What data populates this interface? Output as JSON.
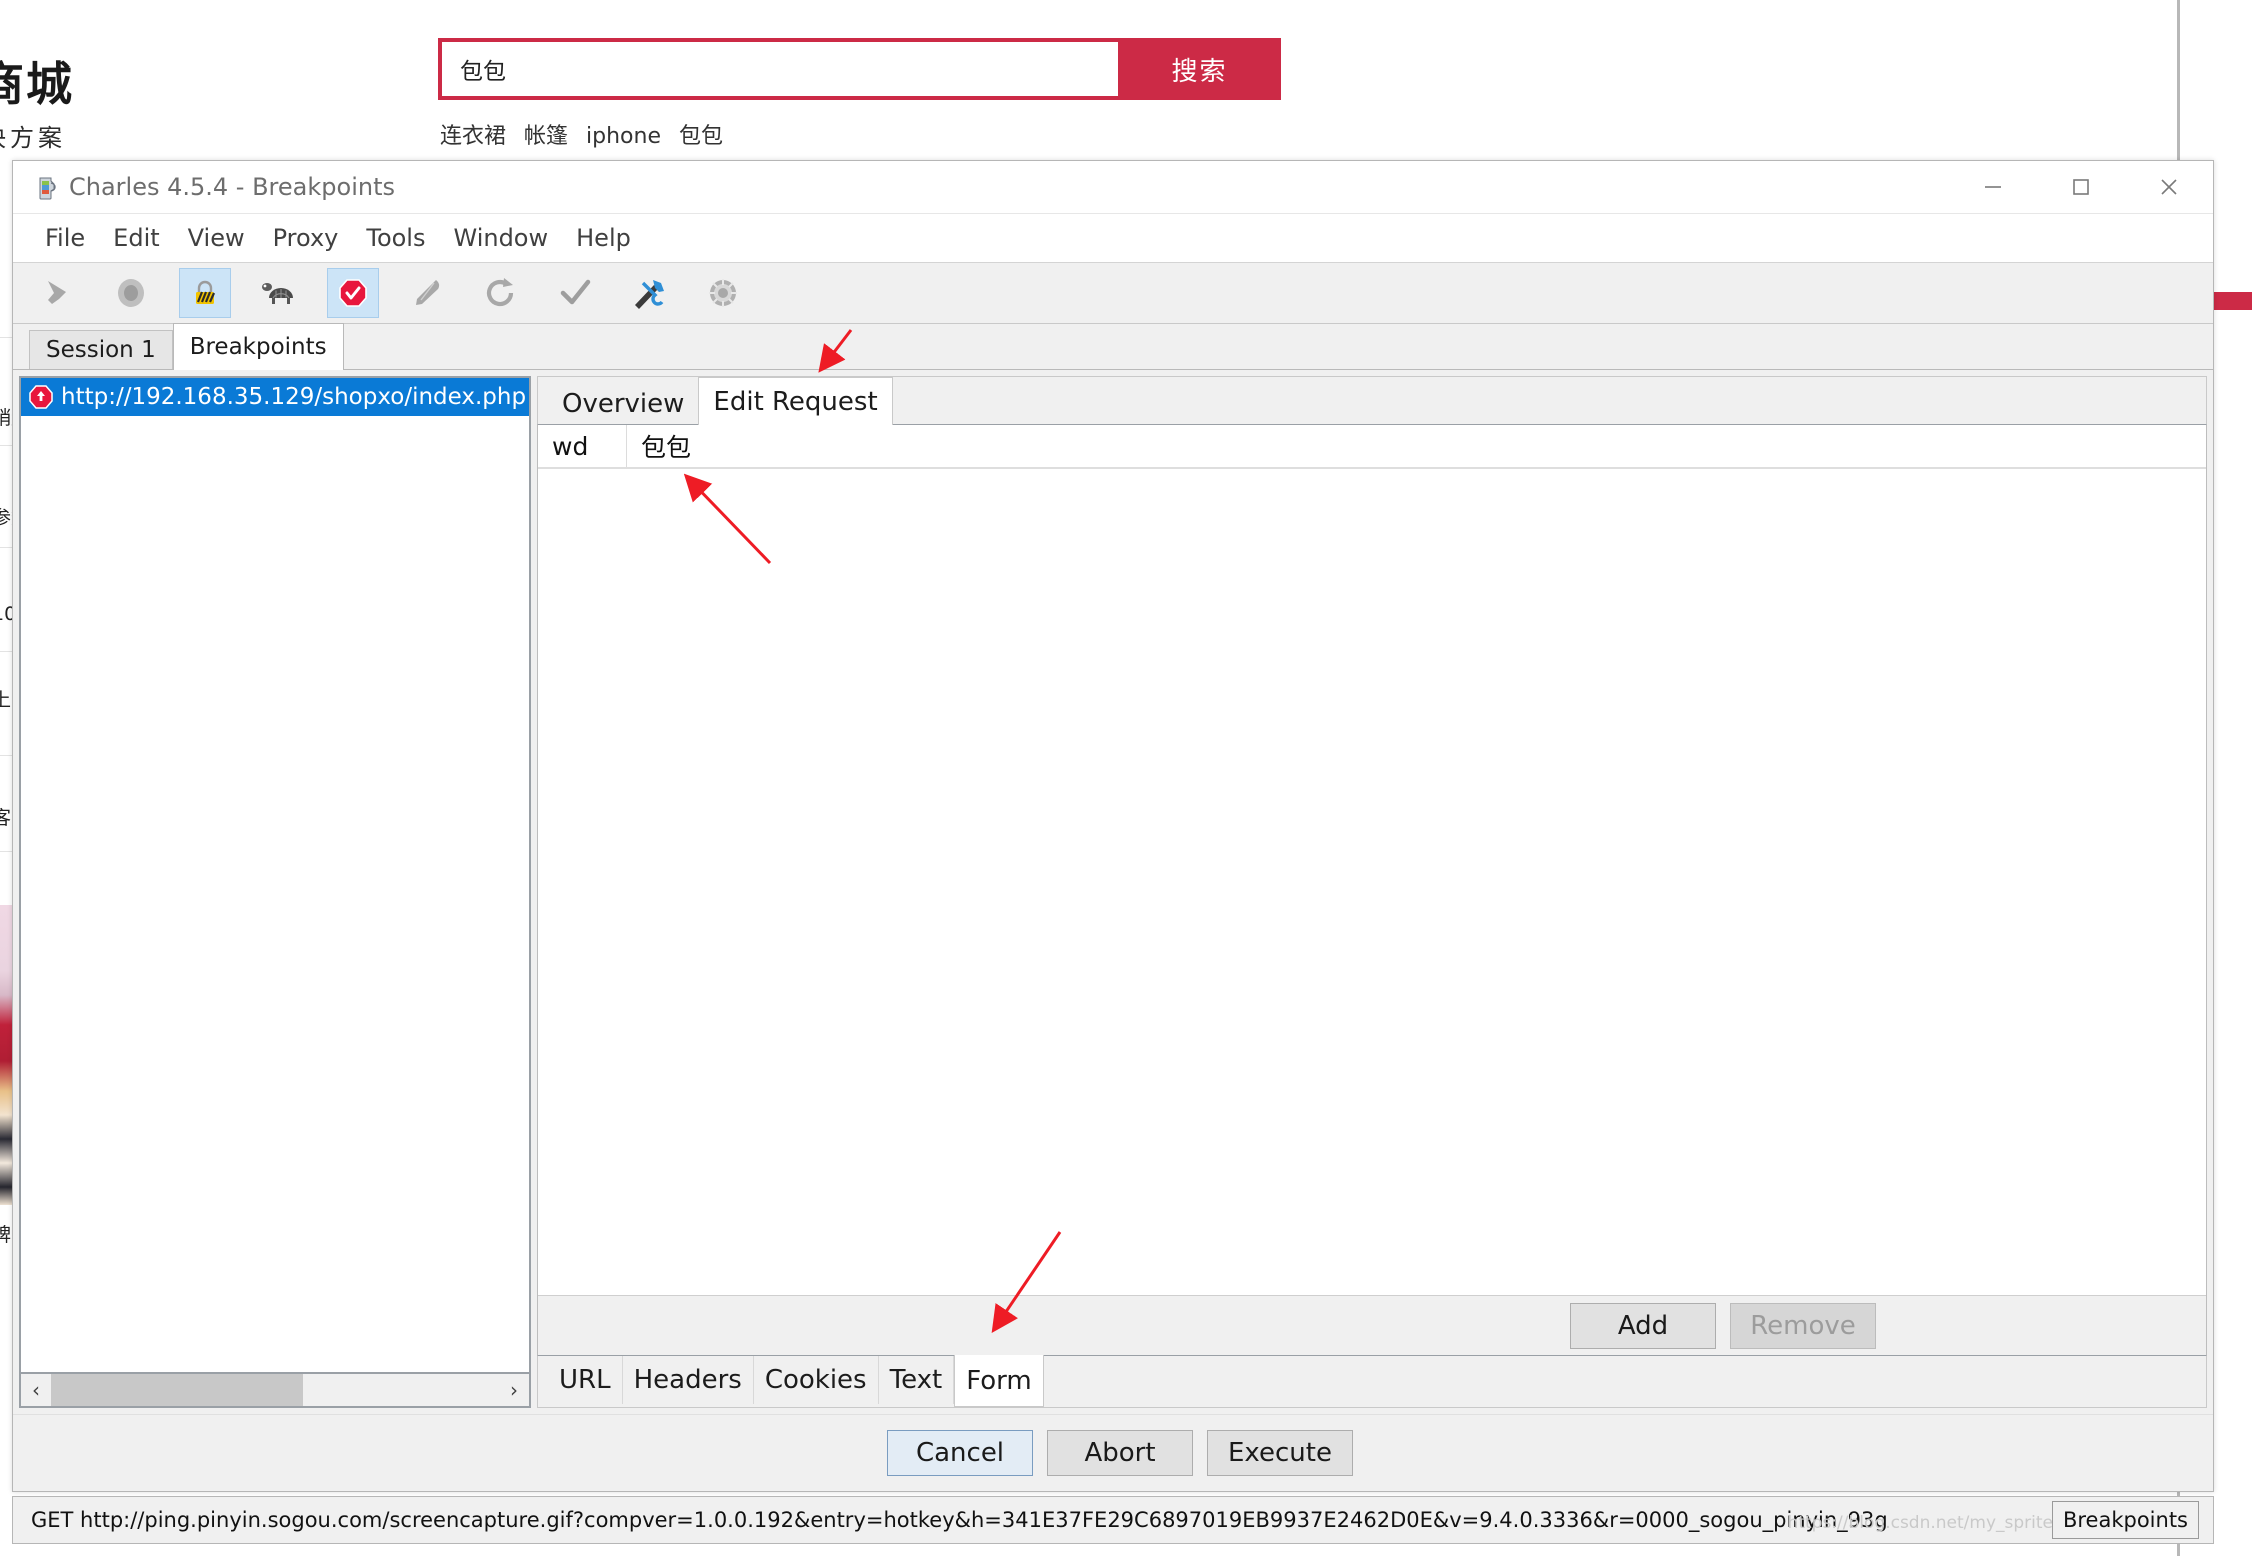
{
  "background_page": {
    "logo": "商城",
    "slogan": "决方案",
    "search": {
      "value": "包包",
      "button_label": "搜索"
    },
    "hot_keywords": [
      "连衣裙",
      "帐篷",
      "iphone",
      "包包"
    ],
    "accent_color": "#cc2a46"
  },
  "window": {
    "title": "Charles 4.5.4 - Breakpoints",
    "icon": "charles-jug-icon",
    "controls": {
      "minimize": "minimize-icon",
      "maximize": "maximize-icon",
      "close": "close-icon"
    }
  },
  "menu": {
    "items": [
      "File",
      "Edit",
      "View",
      "Proxy",
      "Tools",
      "Window",
      "Help"
    ]
  },
  "toolbar": {
    "buttons": [
      {
        "name": "clear-icon",
        "active": false
      },
      {
        "name": "record-icon",
        "active": false
      },
      {
        "name": "ssl-proxying-lock-icon",
        "active": true
      },
      {
        "name": "throttle-turtle-icon",
        "active": false
      },
      {
        "name": "breakpoints-stop-icon",
        "active": true
      },
      {
        "name": "compose-pen-icon",
        "active": false
      },
      {
        "name": "repeat-refresh-icon",
        "active": false
      },
      {
        "name": "validate-check-icon",
        "active": false
      },
      {
        "name": "tools-wrench-icon",
        "active": false
      },
      {
        "name": "settings-gear-icon",
        "active": false
      }
    ]
  },
  "session_tabs": [
    {
      "label": "Session 1",
      "selected": false
    },
    {
      "label": "Breakpoints",
      "selected": true
    }
  ],
  "breakpoint_list": {
    "rows": [
      {
        "icon": "breakpoint-stop-icon",
        "url": "http://192.168.35.129/shopxo/index.php",
        "selected": true
      }
    ],
    "scrollbar": {
      "left_arrow": "‹",
      "right_arrow": "›"
    }
  },
  "detail_tabs": [
    {
      "label": "Overview",
      "selected": false
    },
    {
      "label": "Edit Request",
      "selected": true
    }
  ],
  "form_table": {
    "rows": [
      {
        "name": "wd",
        "value": "包包"
      }
    ]
  },
  "form_buttons": {
    "add": {
      "label": "Add",
      "disabled": false
    },
    "remove": {
      "label": "Remove",
      "disabled": true
    }
  },
  "content_tabs": [
    {
      "label": "URL",
      "selected": false
    },
    {
      "label": "Headers",
      "selected": false
    },
    {
      "label": "Cookies",
      "selected": false
    },
    {
      "label": "Text",
      "selected": false
    },
    {
      "label": "Form",
      "selected": true
    }
  ],
  "action_buttons": [
    {
      "label": "Cancel",
      "style": "default"
    },
    {
      "label": "Abort",
      "style": "normal"
    },
    {
      "label": "Execute",
      "style": "normal"
    }
  ],
  "status_bar": {
    "text": "GET http://ping.pinyin.sogou.com/screencapture.gif?compver=1.0.0.192&entry=hotkey&h=341E37FE29C6897019EB9937E2462D0E&v=9.4.0.3336&r=0000_sogou_pinyin_93g",
    "chip": "Breakpoints",
    "watermark": "https://blog.csdn.net/my_sprite"
  },
  "annotations": [
    {
      "name": "arrow-to-edit-request-tab",
      "color": "#ee1c25"
    },
    {
      "name": "arrow-to-form-value",
      "color": "#ee1c25"
    },
    {
      "name": "arrow-to-form-tab",
      "color": "#ee1c25"
    }
  ]
}
